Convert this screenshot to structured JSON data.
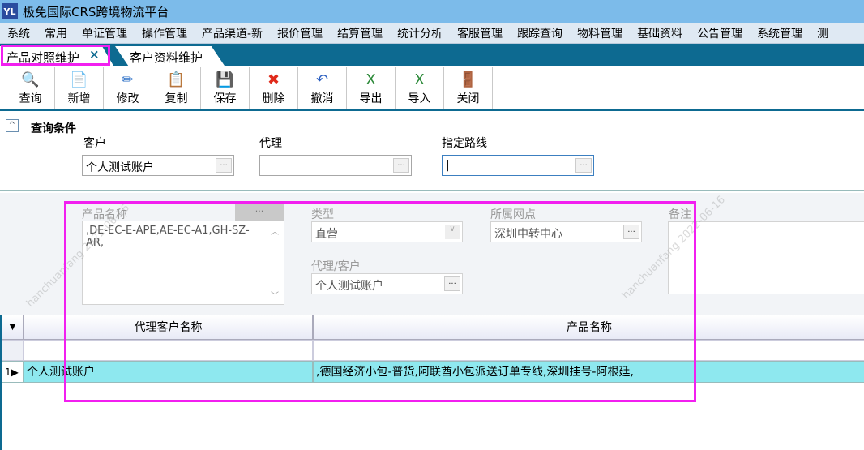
{
  "app": {
    "title": "极免国际CRS跨境物流平台",
    "logo": "YL"
  },
  "menu": [
    "系统",
    "常用",
    "单证管理",
    "操作管理",
    "产品渠道-新",
    "报价管理",
    "结算管理",
    "统计分析",
    "客服管理",
    "跟踪查询",
    "物料管理",
    "基础资料",
    "公告管理",
    "系统管理",
    "测"
  ],
  "tabs": [
    {
      "label": "产品对照维护",
      "close": "×"
    },
    {
      "label": "客户资料维护"
    }
  ],
  "toolbar": [
    {
      "label": "查询",
      "icon": "🔍"
    },
    {
      "label": "新增",
      "icon": "📄"
    },
    {
      "label": "修改",
      "icon": "✏"
    },
    {
      "label": "复制",
      "icon": "📋"
    },
    {
      "label": "保存",
      "icon": "💾"
    },
    {
      "label": "删除",
      "icon": "✖"
    },
    {
      "label": "撤消",
      "icon": "↶"
    },
    {
      "label": "导出",
      "icon": "X"
    },
    {
      "label": "导入",
      "icon": "X"
    },
    {
      "label": "关闭",
      "icon": "🚪"
    }
  ],
  "query": {
    "title": "查询条件",
    "collapse": "^",
    "customer_label": "客户",
    "customer_value": "个人测试账户",
    "agent_label": "代理",
    "agent_value": "",
    "route_label": "指定路线",
    "route_value": "|",
    "dots": "..."
  },
  "form": {
    "product_label": "产品名称",
    "product_value": ",DE-EC-E-APE,AE-EC-A1,GH-SZ-AR,",
    "type_label": "类型",
    "type_value": "直营",
    "outlet_label": "所属网点",
    "outlet_value": "深圳中转中心",
    "remark_label": "备注",
    "agent_customer_label": "代理/客户",
    "agent_customer_value": "个人测试账户"
  },
  "grid": {
    "columns": [
      "代理客户名称",
      "产品名称"
    ],
    "rows": [
      {
        "num": "1",
        "agent": "个人测试账户",
        "products": ",德国经济小包-普货,阿联酋小包派送订单专线,深圳挂号-阿根廷,"
      }
    ]
  },
  "watermark": "hanchuanfang 2022-06-16"
}
